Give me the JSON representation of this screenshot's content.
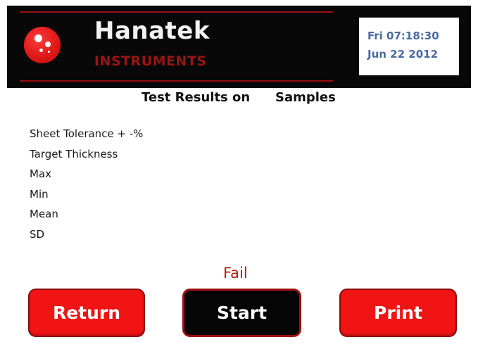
{
  "header": {
    "brand_name": "Hanatek",
    "brand_sub": "INSTRUMENTS",
    "datetime": {
      "line1": "Fri 07:18:30",
      "line2": "Jun 22 2012"
    }
  },
  "title": {
    "prefix": "Test Results on",
    "suffix": "Samples"
  },
  "results": [
    "Sheet Tolerance + -%",
    "Target Thickness",
    "Max",
    "Min",
    "Mean",
    "SD"
  ],
  "status": "Fail",
  "buttons": {
    "return": "Return",
    "start": "Start",
    "print": "Print"
  },
  "colors": {
    "header_bg": "#080808",
    "accent_red": "#f01414",
    "dark_red": "#9c1414",
    "datetime_text": "#4a6aa0",
    "status_text": "#c01818"
  },
  "icons": {
    "logo": "hanatek-logo-icon"
  }
}
